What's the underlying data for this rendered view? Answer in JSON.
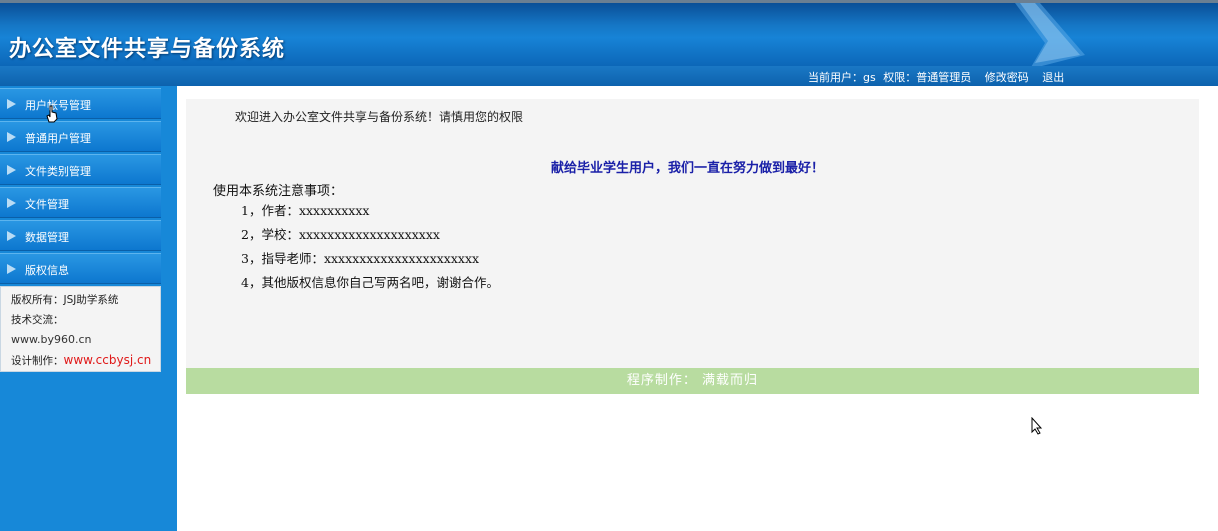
{
  "header": {
    "title": "办公室文件共享与备份系统"
  },
  "userbar": {
    "current_user": "当前用户：gs",
    "permission": "权限：普通管理员",
    "change_password": "修改密码",
    "logout": "退出"
  },
  "sidebar": {
    "items": [
      {
        "label": "用户帐号管理"
      },
      {
        "label": "普通用户管理"
      },
      {
        "label": "文件类别管理"
      },
      {
        "label": "文件管理"
      },
      {
        "label": "数据管理"
      },
      {
        "label": "版权信息"
      }
    ],
    "info": {
      "copyright": "版权所有：JSJ助学系统",
      "tech": "技术交流：",
      "site": "www.by960.cn",
      "design_label": "设计制作：",
      "design_site": "www.ccbysj.cn"
    }
  },
  "main": {
    "welcome": "欢迎进入办公室文件共享与备份系统！请慎用您的权限",
    "slogan": "献给毕业学生用户，我们一直在努力做到最好！",
    "notes_title": "使用本系统注意事项：",
    "notes": [
      "1，作者：xxxxxxxxxx",
      "2，学校：xxxxxxxxxxxxxxxxxxxx",
      "3，指导老师：xxxxxxxxxxxxxxxxxxxxxx",
      "4，其他版权信息你自己写两名吧，谢谢合作。"
    ],
    "footer": "程序制作：  满载而归"
  },
  "colors": {
    "header_blue": "#1576c5",
    "sidebar_blue": "#1788d8",
    "slogan_blue": "#1a20a8",
    "footer_green": "#b8dca0",
    "red_link": "#e01818"
  }
}
